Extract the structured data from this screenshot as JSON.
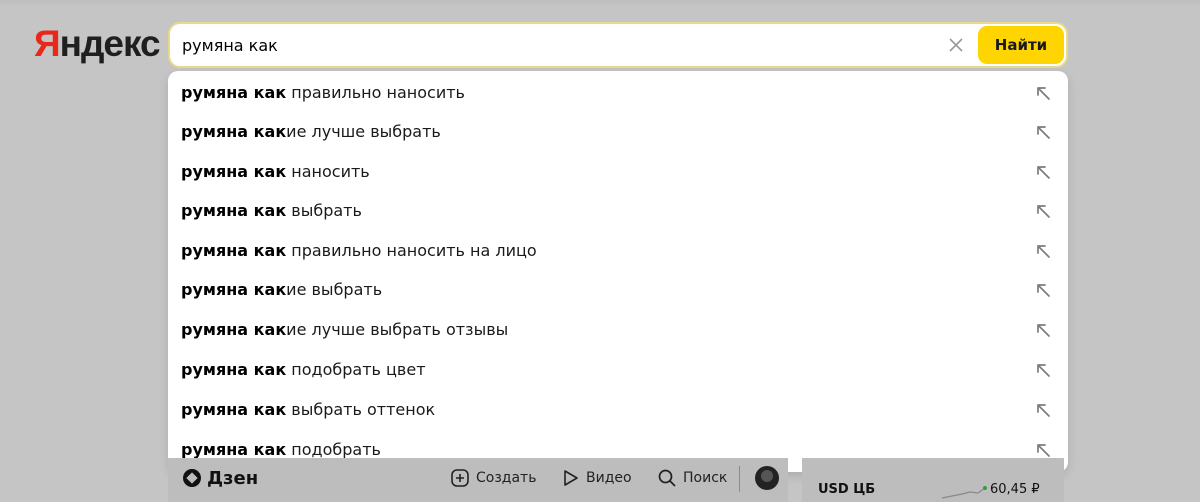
{
  "logo": {
    "first_letter": "Я",
    "rest": "ндекс"
  },
  "search": {
    "query": "румяна как",
    "button_label": "Найти"
  },
  "suggestions": [
    {
      "bold": "румяна как",
      "rest": " правильно наносить"
    },
    {
      "bold": "румяна как",
      "rest": "ие лучше выбрать"
    },
    {
      "bold": "румяна как",
      "rest": " наносить"
    },
    {
      "bold": "румяна как",
      "rest": " выбрать"
    },
    {
      "bold": "румяна как",
      "rest": " правильно наносить на лицо"
    },
    {
      "bold": "румяна как",
      "rest": "ие выбрать"
    },
    {
      "bold": "румяна как",
      "rest": "ие лучше выбрать отзывы"
    },
    {
      "bold": "румяна как",
      "rest": " подобрать цвет"
    },
    {
      "bold": "румяна как",
      "rest": " выбрать оттенок"
    },
    {
      "bold": "румяна как",
      "rest": " подобрать"
    }
  ],
  "bottom_nav": {
    "brand": "Дзен",
    "create": "Создать",
    "video": "Видео",
    "search": "Поиск"
  },
  "rates": {
    "label": "USD ЦБ",
    "value": "60,45 ₽"
  },
  "icons": {
    "clear": "close-icon",
    "suggestion_arrow": "arrow-up-left-icon",
    "create": "plus-square-icon",
    "video": "play-icon",
    "search": "search-icon",
    "dzen": "dzen-logo-icon"
  },
  "colors": {
    "accent": "#fed500",
    "logo_red": "#e8281a",
    "input_border": "#e9d98a"
  }
}
